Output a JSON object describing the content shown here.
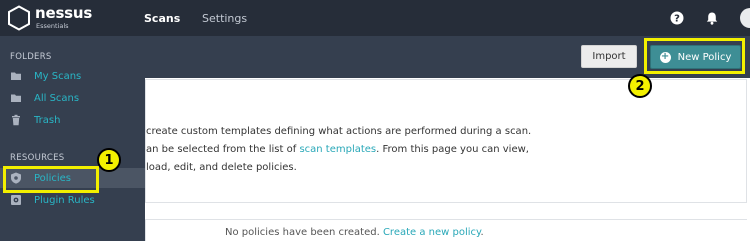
{
  "app": {
    "name": "nessus",
    "edition": "Essentials"
  },
  "topnav": {
    "tabs": [
      {
        "label": "Scans",
        "active": true
      },
      {
        "label": "Settings",
        "active": false
      }
    ],
    "icons": [
      "help-icon",
      "bell-icon",
      "avatar"
    ]
  },
  "sidebar": {
    "folders_heading": "FOLDERS",
    "folders": [
      {
        "label": "My Scans",
        "icon": "folder-icon"
      },
      {
        "label": "All Scans",
        "icon": "folder-icon"
      },
      {
        "label": "Trash",
        "icon": "trash-icon"
      }
    ],
    "resources_heading": "RESOURCES",
    "resources": [
      {
        "label": "Policies",
        "icon": "shield-icon",
        "active": true
      },
      {
        "label": "Plugin Rules",
        "icon": "plugin-icon",
        "active": false
      }
    ]
  },
  "toolbar": {
    "import_label": "Import",
    "new_policy_label": "New Policy"
  },
  "panel": {
    "line1": "create custom templates defining what actions are performed during a scan.",
    "line2_a": "an be selected from the list of ",
    "line2_link": "scan templates",
    "line2_b": ". From this page you can view,",
    "line3": "load, edit, and delete policies."
  },
  "empty_state": {
    "text": "No policies have been created. ",
    "link": "Create a new policy",
    "suffix": "."
  },
  "callouts": [
    {
      "number": "1"
    },
    {
      "number": "2"
    }
  ],
  "colors": {
    "accent": "#29b6c6",
    "nav_bg": "#262d39",
    "sidebar_bg": "#353f4f",
    "primary_button": "#3e8e95",
    "highlight": "#f3f000"
  }
}
